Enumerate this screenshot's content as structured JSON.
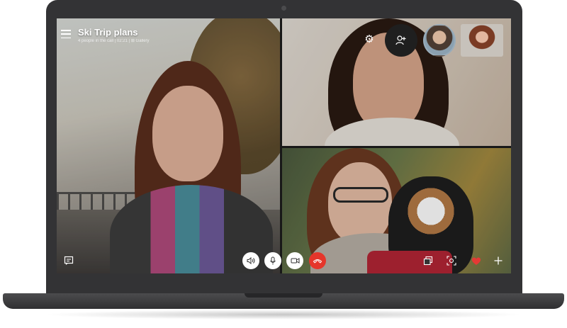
{
  "call": {
    "title": "Ski Trip plans",
    "subtitle": "4 people in the call | 02:21 | ⊞ Gallery"
  },
  "icons": {
    "menu": "hamburger-menu-icon",
    "settings": "gear-icon",
    "add_people": "add-person-icon",
    "chat": "chat-icon",
    "volume": "speaker-icon",
    "mic": "microphone-icon",
    "video": "video-camera-icon",
    "end_call": "hang-up-icon",
    "share": "share-screen-icon",
    "snapshot": "snapshot-icon",
    "react": "heart-icon",
    "more": "plus-icon"
  },
  "colors": {
    "end_call": "#e5362b",
    "heart": "#e53935",
    "laptop": "#333335"
  }
}
